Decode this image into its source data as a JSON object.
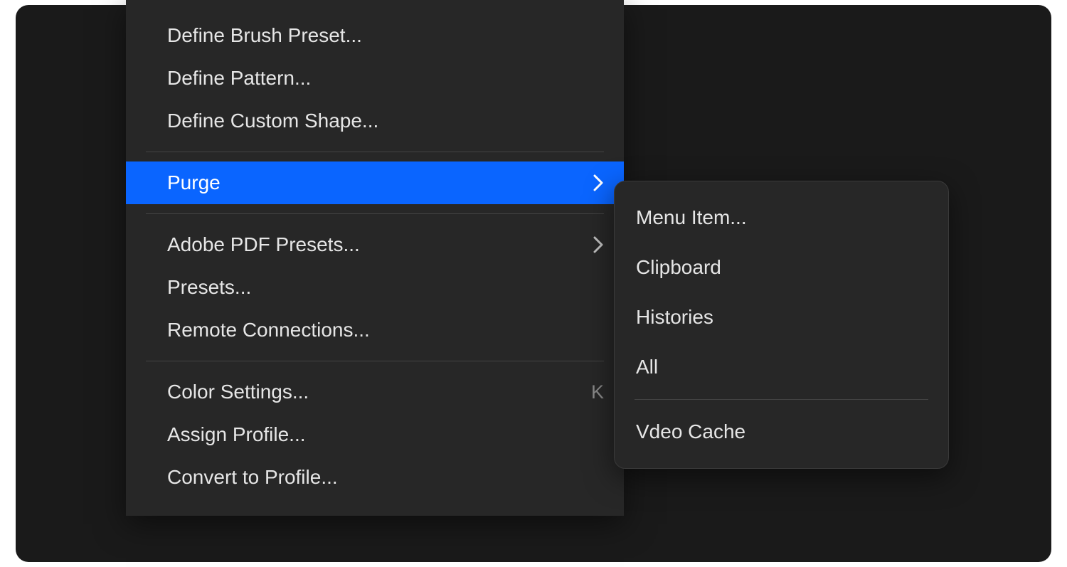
{
  "main_menu": {
    "items": [
      {
        "label": "Define Brush Preset...",
        "type": "item"
      },
      {
        "label": "Define Pattern...",
        "type": "item"
      },
      {
        "label": "Define Custom Shape...",
        "type": "item"
      },
      {
        "type": "sep"
      },
      {
        "label": "Purge",
        "type": "submenu",
        "highlighted": true
      },
      {
        "type": "sep"
      },
      {
        "label": "Adobe PDF Presets...",
        "type": "submenu"
      },
      {
        "label": "Presets...",
        "type": "item"
      },
      {
        "label": "Remote Connections...",
        "type": "item"
      },
      {
        "type": "sep"
      },
      {
        "label": "Color Settings...",
        "type": "item",
        "shortcut": "K"
      },
      {
        "label": "Assign Profile...",
        "type": "item"
      },
      {
        "label": "Convert to Profile...",
        "type": "item"
      }
    ]
  },
  "sub_menu": {
    "items": [
      {
        "label": "Menu Item...",
        "type": "item"
      },
      {
        "label": "Clipboard",
        "type": "item"
      },
      {
        "label": "Histories",
        "type": "item"
      },
      {
        "label": "All",
        "type": "item"
      },
      {
        "type": "sep"
      },
      {
        "label": "Vdeo Cache",
        "type": "item"
      }
    ]
  },
  "colors": {
    "highlight": "#0a65ff",
    "panel": "#272727",
    "background": "#1a1a1a"
  }
}
